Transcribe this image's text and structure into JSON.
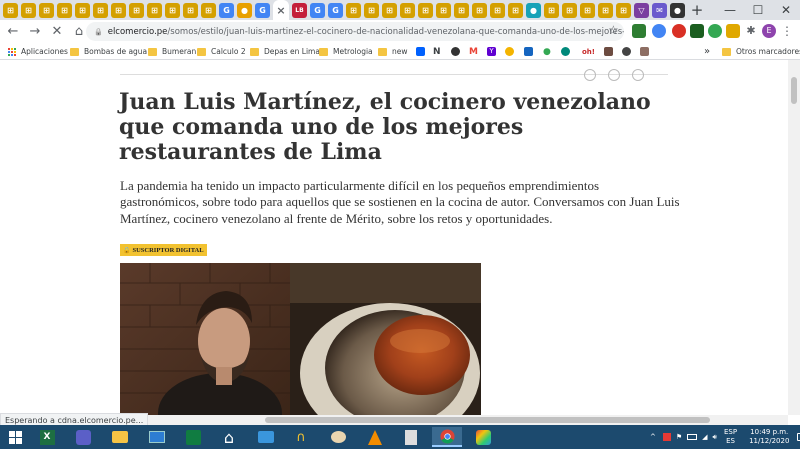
{
  "tabs": {
    "active_close": "×",
    "new_tab": "+",
    "favicons": [
      {
        "c": "#d4a000",
        "t": "⊞"
      },
      {
        "c": "#d4a000",
        "t": "⊞"
      },
      {
        "c": "#d4a000",
        "t": "⊞"
      },
      {
        "c": "#d4a000",
        "t": "⊞"
      },
      {
        "c": "#d4a000",
        "t": "⊞"
      },
      {
        "c": "#d4a000",
        "t": "⊞"
      },
      {
        "c": "#d4a000",
        "t": "⊞"
      },
      {
        "c": "#d4a000",
        "t": "⊞"
      },
      {
        "c": "#d4a000",
        "t": "⊞"
      },
      {
        "c": "#d4a000",
        "t": "⊞"
      },
      {
        "c": "#d4a000",
        "t": "⊞"
      },
      {
        "c": "#d4a000",
        "t": "⊞"
      },
      {
        "c": "#4285f4",
        "t": "G"
      },
      {
        "c": "#e8a000",
        "t": "●"
      },
      {
        "c": "#4285f4",
        "t": "G"
      }
    ],
    "favicons_after": [
      {
        "c": "#c41e3a",
        "t": "LB"
      },
      {
        "c": "#4285f4",
        "t": "G"
      },
      {
        "c": "#4285f4",
        "t": "G"
      },
      {
        "c": "#d4a000",
        "t": "⊞"
      },
      {
        "c": "#d4a000",
        "t": "⊞"
      },
      {
        "c": "#d4a000",
        "t": "⊞"
      },
      {
        "c": "#d4a000",
        "t": "⊞"
      },
      {
        "c": "#d4a000",
        "t": "⊞"
      },
      {
        "c": "#d4a000",
        "t": "⊞"
      },
      {
        "c": "#d4a000",
        "t": "⊞"
      },
      {
        "c": "#d4a000",
        "t": "⊞"
      },
      {
        "c": "#d4a000",
        "t": "⊞"
      },
      {
        "c": "#d4a000",
        "t": "⊞"
      },
      {
        "c": "#17a2b8",
        "t": "●"
      },
      {
        "c": "#d4a000",
        "t": "⊞"
      },
      {
        "c": "#d4a000",
        "t": "⊞"
      },
      {
        "c": "#d4a000",
        "t": "⊞"
      },
      {
        "c": "#d4a000",
        "t": "⊞"
      },
      {
        "c": "#d4a000",
        "t": "⊞"
      },
      {
        "c": "#7b3fa0",
        "t": "▽"
      },
      {
        "c": "#6a5acd",
        "t": "✉"
      },
      {
        "c": "#333",
        "t": "●"
      }
    ]
  },
  "window": {
    "minimize": "—",
    "maximize": "☐",
    "close": "✕"
  },
  "toolbar": {
    "back": "←",
    "forward": "→",
    "reload": "✕",
    "home": "⌂"
  },
  "omnibox": {
    "lock": "🔒",
    "domain": "elcomercio.pe",
    "path": "/somos/estilo/juan-luis-martinez-el-cocinero-de-nacionalidad-venezolana-que-comanda-uno-de-los-mejores-restaurante...",
    "star": "☆"
  },
  "profile_initial": "E",
  "menu": "⋮",
  "bookmarks": {
    "apps": "Aplicaciones",
    "items": [
      "Bombas de agua",
      "Bumeran",
      "Calculo 2",
      "Depas en Lima",
      "Metrologia",
      "new"
    ],
    "more": "»",
    "others": "Otros marcadores"
  },
  "article": {
    "title": "Juan Luis Martínez, el cocinero venezolano que comanda uno de los mejores restaurantes de Lima",
    "lead": "La pandemia ha tenido un impacto particularmente difícil en los pequeños emprendimientos gastronómicos, sobre todo para aquellos que se sostienen en la cocina de autor. Conversamos con Juan Luis Martínez, cocinero venezolano al frente de Mérito, sobre los retos y oportunidades.",
    "badge": "SUSCRIPTOR DIGITAL"
  },
  "status_text": "Esperando a cdna.elcomercio.pe...",
  "taskbar": {
    "lang_top": "ESP",
    "lang_bottom": "ES",
    "time": "10:49 p.m.",
    "date": "11/12/2020"
  },
  "colors": {
    "badge": "#f2c230",
    "taskbar": "#1c4a6e",
    "title": "#333333"
  }
}
